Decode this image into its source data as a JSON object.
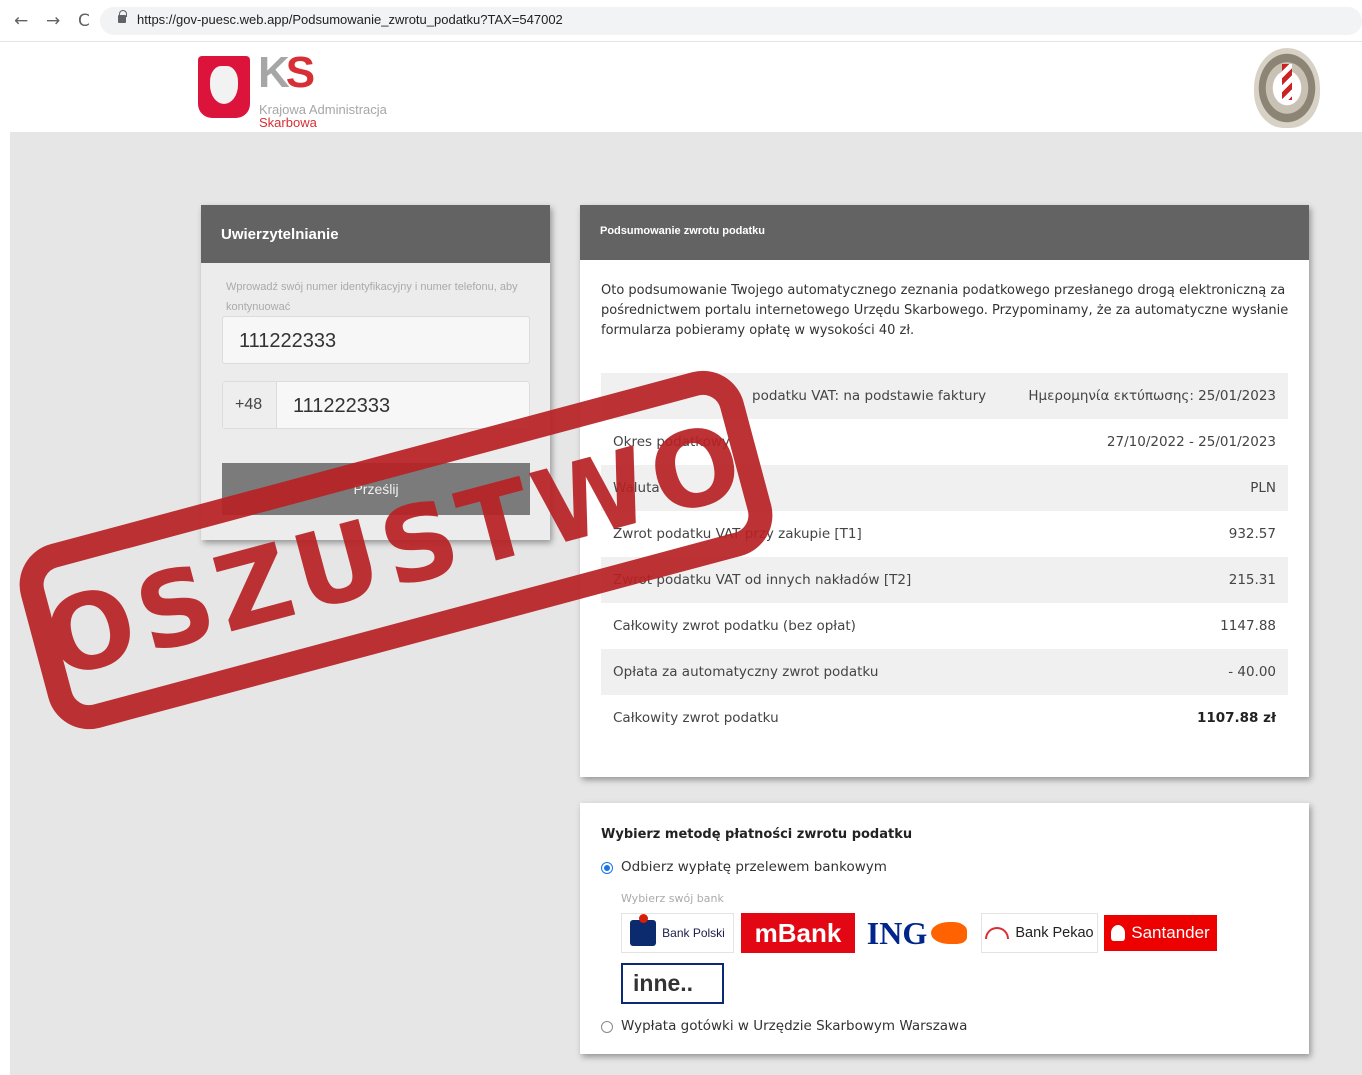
{
  "browser": {
    "back": "←",
    "forward": "→",
    "reload": "C",
    "url": "https://gov-puesc.web.app/Podsumowanie_zwrotu_podatku?TAX=547002"
  },
  "header": {
    "logo_mark": "K",
    "logo_mark_accent": "S",
    "logo_line1": "Krajowa Administracja",
    "logo_line2": "Skarbowa"
  },
  "auth": {
    "title": "Uwierzytelnianie",
    "hint": "Wprowadź swój numer identyfikacyjny i numer telefonu, aby kontynuować",
    "id_value": "111222333",
    "phone_prefix": "+48",
    "phone_value": "111222333",
    "submit_label": "Prześlij"
  },
  "summary": {
    "title": "Podsumowanie zwrotu podatku",
    "intro": "Oto podsumowanie Twojego automatycznego zeznania podatkowego przesłanego drogą elektroniczną za pośrednictwem portalu internetowego Urzędu Skarbowego. Przypominamy, że za automatyczne wysłanie formularza pobieramy opłatę w wysokości 40 zł.",
    "rows": [
      {
        "label": "podatku VAT: na podstawie faktury",
        "value": "Ημερομηνία εκτύπωσης: 25/01/2023"
      },
      {
        "label": "Okres podatkowy",
        "value": "27/10/2022 - 25/01/2023"
      },
      {
        "label": "Waluta",
        "value": "PLN"
      },
      {
        "label": "Zwrot podatku VAT przy zakupie [T1]",
        "value": "932.57"
      },
      {
        "label": "Zwrot podatku VAT od innych nakładów [T2]",
        "value": "215.31"
      },
      {
        "label": "Całkowity zwrot podatku (bez opłat)",
        "value": "1147.88"
      },
      {
        "label": "Opłata za automatyczny zwrot podatku",
        "value": "- 40.00"
      },
      {
        "label": "Całkowity zwrot podatku",
        "value": "1107.88 zł"
      }
    ]
  },
  "payment": {
    "title": "Wybierz metodę płatności zwrotu podatku",
    "option_bank": "Odbierz wypłatę przelewem bankowym",
    "bank_hint": "Wybierz swój bank",
    "banks": {
      "pko": "Bank Polski",
      "mbank": "mBank",
      "ing": "ING",
      "pekao": "Bank Pekao",
      "santander": "Santander"
    },
    "other_bank": "inne..",
    "option_cash": "Wypłata gotówki w Urzędzie Skarbowym Warszawa"
  },
  "stamp": {
    "text": "OSZUSTWO",
    "color": "#b82124"
  },
  "colors": {
    "header_bar": "#636363",
    "page_bg": "#e6e6e6",
    "accent_red": "#d72f35"
  }
}
